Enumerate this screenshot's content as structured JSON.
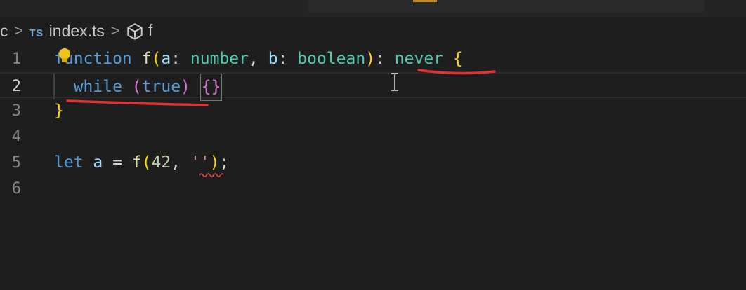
{
  "breadcrumb": {
    "folder": "c",
    "file_badge": "TS",
    "file": "index.ts",
    "symbol": "f"
  },
  "editor": {
    "active_line": 2,
    "line_numbers": [
      "1",
      "2",
      "3",
      "4",
      "5",
      "6"
    ],
    "lines": [
      {
        "tokens": [
          {
            "t": "function",
            "c": "kw"
          },
          {
            "t": " ",
            "c": "plain"
          },
          {
            "t": "f",
            "c": "fn"
          },
          {
            "t": "(",
            "c": "brace-y"
          },
          {
            "t": "a",
            "c": "param"
          },
          {
            "t": ": ",
            "c": "plain"
          },
          {
            "t": "number",
            "c": "type"
          },
          {
            "t": ", ",
            "c": "plain"
          },
          {
            "t": "b",
            "c": "param"
          },
          {
            "t": ": ",
            "c": "plain"
          },
          {
            "t": "boolean",
            "c": "type"
          },
          {
            "t": ")",
            "c": "brace-y"
          },
          {
            "t": ": ",
            "c": "plain"
          },
          {
            "t": "never",
            "c": "never"
          },
          {
            "t": " ",
            "c": "plain"
          },
          {
            "t": "{",
            "c": "brace-y"
          }
        ]
      },
      {
        "tokens": [
          {
            "t": "  while",
            "c": "kw"
          },
          {
            "t": " ",
            "c": "plain"
          },
          {
            "t": "(",
            "c": "brace-p"
          },
          {
            "t": "true",
            "c": "kw"
          },
          {
            "t": ")",
            "c": "brace-p"
          },
          {
            "t": " ",
            "c": "plain"
          },
          {
            "t": "{}",
            "c": "brace-p",
            "boxed": true
          }
        ]
      },
      {
        "tokens": [
          {
            "t": "}",
            "c": "brace-y"
          }
        ]
      },
      {
        "tokens": []
      },
      {
        "tokens": [
          {
            "t": "let",
            "c": "kw"
          },
          {
            "t": " ",
            "c": "plain"
          },
          {
            "t": "a",
            "c": "param"
          },
          {
            "t": " = ",
            "c": "plain"
          },
          {
            "t": "f",
            "c": "fn"
          },
          {
            "t": "(",
            "c": "brace-y"
          },
          {
            "t": "42",
            "c": "num"
          },
          {
            "t": ", ",
            "c": "plain"
          },
          {
            "t": "''",
            "c": "str"
          },
          {
            "t": ")",
            "c": "brace-y"
          },
          {
            "t": ";",
            "c": "plain"
          }
        ]
      },
      {
        "tokens": []
      }
    ]
  },
  "colors": {
    "background": "#1e1e1e",
    "annotation_red": "#e0322f",
    "error_squiggle": "#f14c4c"
  }
}
